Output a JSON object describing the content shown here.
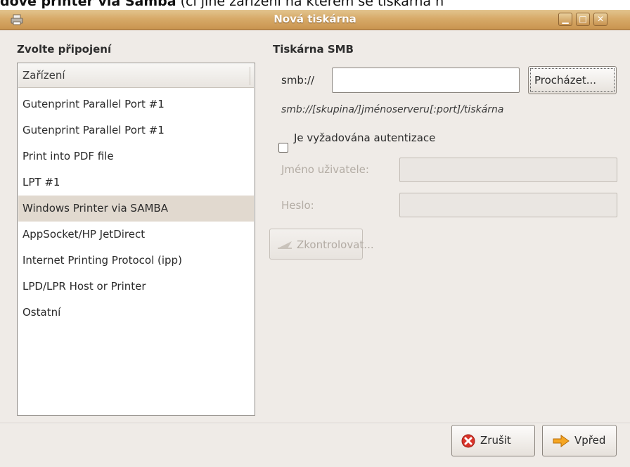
{
  "page_strip": {
    "bold_text": "dové printer via Samba",
    "rest_text": " (či jiné zařízení na kterém se tiskárna n"
  },
  "window": {
    "title": "Nová tiskárna"
  },
  "left": {
    "section_title": "Zvolte připojení",
    "list_header": "Zařízení",
    "items": [
      "Gutenprint Parallel Port #1",
      "Gutenprint Parallel Port #1",
      "Print into PDF file",
      "LPT #1",
      "Windows Printer via SAMBA",
      "AppSocket/HP JetDirect",
      "Internet Printing Protocol (ipp)",
      "LPD/LPR Host or Printer",
      "Ostatní"
    ],
    "selected_index": 4
  },
  "right": {
    "section_title": "Tiskárna SMB",
    "smb_label": "smb://",
    "smb_value": "",
    "browse_button": "Procházet...",
    "hint": "smb://[skupina/]jménoserveru[:port]/tiskárna",
    "auth_checkbox_label": "Je vyžadována autentizace",
    "auth_checked": false,
    "username_label": "Jméno uživatele:",
    "password_label": "Heslo:",
    "verify_button": "Zkontrolovat..."
  },
  "footer": {
    "cancel_button": "Zrušit",
    "forward_button": "Vpřed"
  },
  "colors": {
    "titlebar": "#d7aa68",
    "selection": "#e1d9cf",
    "cancel_icon": "#d9342a",
    "forward_icon": "#f5a623"
  }
}
